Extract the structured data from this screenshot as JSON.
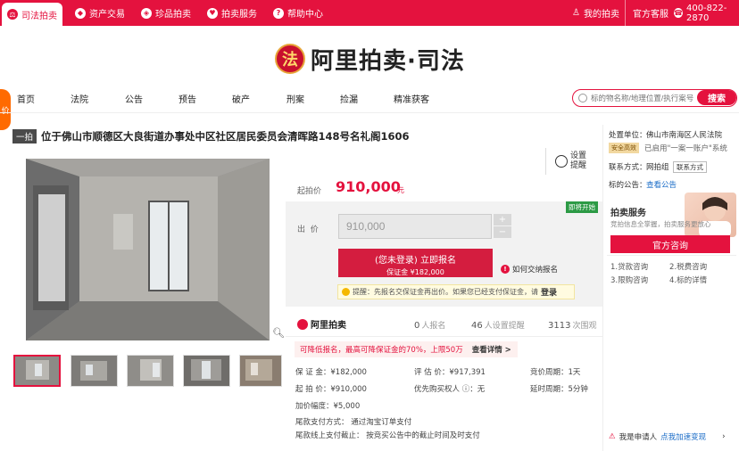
{
  "topbar": {
    "tabs": [
      {
        "label": "司法拍卖",
        "icon": "gavel-icon"
      },
      {
        "label": "资产交易",
        "icon": "asset-icon"
      },
      {
        "label": "珍品拍卖",
        "icon": "treasure-icon"
      },
      {
        "label": "拍卖服务",
        "icon": "heart-icon"
      },
      {
        "label": "帮助中心",
        "icon": "help-icon"
      }
    ],
    "my_auction": "我的拍卖",
    "customer_service": "官方客服",
    "phone": "400-822-2870"
  },
  "logo": {
    "text": "阿里拍卖·司法",
    "emblem_glyph": "法"
  },
  "nav": {
    "items": [
      "首页",
      "法院",
      "公告",
      "预告",
      "破产",
      "刑案",
      "捡漏",
      "精准获客"
    ]
  },
  "search": {
    "placeholder": "标的物名称/地理位置/执行案号",
    "button": "搜索"
  },
  "sidetab": {
    "label": "价"
  },
  "lot": {
    "tag": "一拍",
    "title": "位于佛山市顺德区大良街道办事处中区社区居民委员会清晖路148号名礼阁1606"
  },
  "remind": {
    "label": "设置提醒"
  },
  "price": {
    "start_label": "起拍价",
    "start_value": "910,000",
    "start_unit": "元",
    "soon_badge": "即将开始",
    "offer_label": "出  价",
    "offer_value": "910,000",
    "plus": "+",
    "minus": "−",
    "signup_line1": "(您未登录) 立即报名",
    "signup_line2": "保证金 ¥182,000",
    "howto": "如何交纳报名",
    "tip": "提醒：先报名交保证金再出价。如果您已经支付保证金，请",
    "tip_login": "登录"
  },
  "stats": {
    "brand": "阿里拍卖",
    "signups_n": "0",
    "signups_label": "人报名",
    "reminders_n": "46",
    "reminders_label": "人设置提醒",
    "views_n": "3113",
    "views_label": "次围观"
  },
  "installment": {
    "text": "可降低报名，最高可降保证金的70%，上限50万",
    "more": "查看详情 >"
  },
  "info": {
    "deposit": "保 证 金：¥182,000",
    "appraisal": "评 估 价：¥917,391",
    "cycle": "竞价周期：1天",
    "start": "起 拍 价：¥910,000",
    "priority": "优先购买权人 ⓘ：无",
    "delay": "延时周期：5分钟",
    "increment": "加价幅度：¥5,000",
    "pay_method": "尾款支付方式：  通过淘宝订单支付",
    "pay_deadline": "尾款线上支付截止：  按竞买公告中的截止时间及时支付"
  },
  "right": {
    "unit_label": "处置单位：",
    "unit_value": "佛山市南海区人民法院",
    "safe_badge": "安全高效",
    "safe_text": "已启用\"一案一账户\"系统",
    "contact_label": "联系方式：",
    "contact_value": "网拍组",
    "contact_badge": "联系方式",
    "notice_label": "标的公告：",
    "notice_link": "查看公告",
    "service_title": "拍卖服务",
    "service_desc": "竞拍信息全掌握，拍卖服务更放心",
    "consult_btn": "官方咨询",
    "items": [
      "1.贷款咨询",
      "2.税费咨询",
      "3.限购咨询",
      "4.标的详情"
    ],
    "applicant": "我是申请人",
    "applicant_link": "点我加速变现"
  },
  "colors": {
    "brand_red": "#e4123e",
    "green_badge": "#2c9a45"
  }
}
